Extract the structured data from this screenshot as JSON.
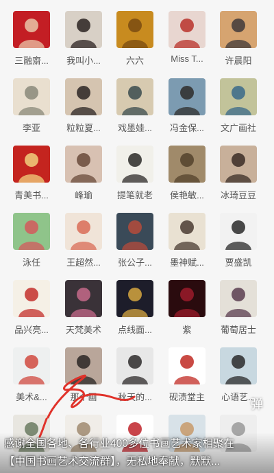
{
  "grid": {
    "contacts": [
      {
        "name": "三融齋...",
        "colors": [
          "#c31e24",
          "#e9c6a8"
        ]
      },
      {
        "name": "我叫小...",
        "colors": [
          "#d8d0c6",
          "#2c2321"
        ]
      },
      {
        "name": "六六",
        "colors": [
          "#c88b1f",
          "#7a4b12"
        ]
      },
      {
        "name": "Miss T...",
        "colors": [
          "#e8d6d0",
          "#b9322b"
        ]
      },
      {
        "name": "许晨阳",
        "colors": [
          "#d6a470",
          "#3f3a39"
        ]
      },
      {
        "name": "李亚",
        "colors": [
          "#e9dfcf",
          "#8a8a7a"
        ]
      },
      {
        "name": "粒粒夏...",
        "colors": [
          "#d5c4b0",
          "#2b2624"
        ]
      },
      {
        "name": "戏墨娃...",
        "colors": [
          "#d7cab0",
          "#3b4c4f"
        ]
      },
      {
        "name": "冯金保...",
        "colors": [
          "#7c9bb1",
          "#2f2d2c"
        ]
      },
      {
        "name": "文广画社",
        "colors": [
          "#c2c39a",
          "#3a6a8a"
        ]
      },
      {
        "name": "青美书...",
        "colors": [
          "#c4241f",
          "#f1d07e"
        ]
      },
      {
        "name": "峰瑜",
        "colors": [
          "#d8c1b2",
          "#6a4a3a"
        ]
      },
      {
        "name": "提笔就老",
        "colors": [
          "#f1f0ea",
          "#2c2a28"
        ]
      },
      {
        "name": "侯艳敏...",
        "colors": [
          "#a08a6a",
          "#54422c"
        ]
      },
      {
        "name": "冰琦豆豆",
        "colors": [
          "#c8b09a",
          "#3b2d26"
        ]
      },
      {
        "name": "泳任",
        "colors": [
          "#8fc48a",
          "#d35a5c"
        ]
      },
      {
        "name": "王超然...",
        "colors": [
          "#f0e4d8",
          "#d96c57"
        ]
      },
      {
        "name": "张公子...",
        "colors": [
          "#3a4a58",
          "#b54b3b"
        ]
      },
      {
        "name": "墨神赋...",
        "colors": [
          "#e9e1d2",
          "#4a3b32"
        ]
      },
      {
        "name": "贾盛凯",
        "colors": [
          "#f2f2f2",
          "#2a2a2a"
        ]
      },
      {
        "name": "品兴亮...",
        "colors": [
          "#f5f0e6",
          "#c3302c"
        ]
      },
      {
        "name": "天梵美术",
        "colors": [
          "#3a3238",
          "#c66a8a"
        ]
      },
      {
        "name": "点线面...",
        "colors": [
          "#1d1d2a",
          "#d5a640"
        ]
      },
      {
        "name": "紫",
        "colors": [
          "#2a0b0e",
          "#9b1b2a"
        ]
      },
      {
        "name": "葡萄居士",
        "colors": [
          "#e4e0d8",
          "#5b3d50"
        ]
      },
      {
        "name": "美术&...",
        "colors": [
          "#eef0f0",
          "#d04a40"
        ]
      },
      {
        "name": "那个画",
        "colors": [
          "#b9a69a",
          "#2a2624"
        ]
      },
      {
        "name": "秋天的...",
        "colors": [
          "#e7e7e7",
          "#2d2a2a"
        ]
      },
      {
        "name": "砚渍堂主",
        "colors": [
          "#ffffff",
          "#c02a23"
        ]
      },
      {
        "name": "心语艺...",
        "colors": [
          "#c8d8e0",
          "#2a2a2a"
        ]
      },
      {
        "name": "",
        "colors": [
          "#e8e6e0",
          "#6a7a60"
        ]
      },
      {
        "name": "",
        "colors": [
          "#f0ede8",
          "#a08a70"
        ]
      },
      {
        "name": "",
        "colors": [
          "#ffffff",
          "#c0232a"
        ]
      },
      {
        "name": "",
        "colors": [
          "#d8e2e8",
          "#c89a6a"
        ]
      },
      {
        "name": "",
        "colors": [
          "#eee",
          "#999"
        ]
      }
    ]
  },
  "danmu_icon": "弹",
  "caption": {
    "line1": "感谢全国各地、各行业400多位书画艺术家相聚在",
    "line2": "【中国书画艺术交流群】，无私地奉献，默默..."
  },
  "colors": {
    "scribble": "#e0322a",
    "background": "#f6f6f6"
  }
}
